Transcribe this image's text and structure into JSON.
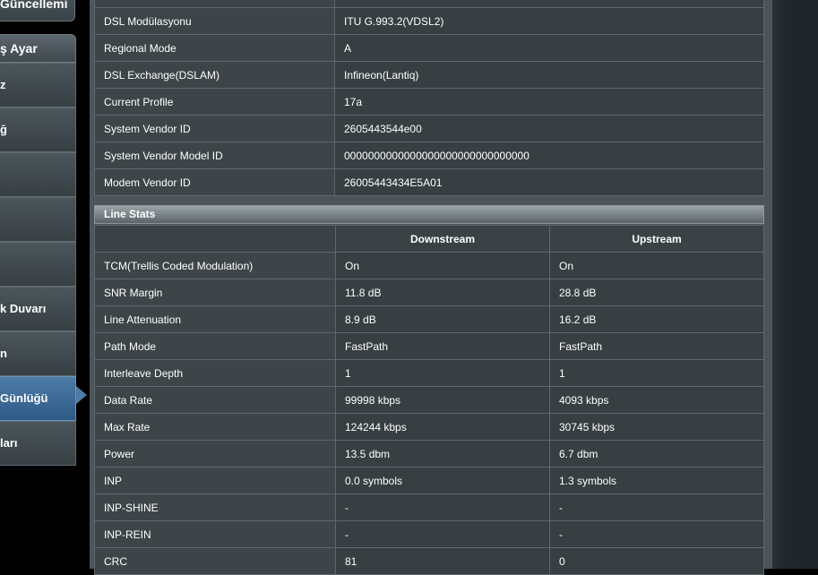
{
  "sidebar": {
    "top_item": "Güncellemi",
    "header": "ş Ayar",
    "items": [
      {
        "label": "z"
      },
      {
        "label": "ğ"
      },
      {
        "label": ""
      },
      {
        "label": ""
      },
      {
        "label": ""
      },
      {
        "label": "k Duvarı"
      },
      {
        "label": "n"
      },
      {
        "label": "Günlüğü",
        "active": true
      },
      {
        "label": "ları"
      }
    ]
  },
  "info": {
    "rows": [
      {
        "label": "",
        "value": ""
      },
      {
        "label": "DSL Modülasyonu",
        "value": "ITU G.993.2(VDSL2)"
      },
      {
        "label": "Regional Mode",
        "value": "A"
      },
      {
        "label": "DSL Exchange(DSLAM)",
        "value": "Infineon(Lantiq)"
      },
      {
        "label": "Current Profile",
        "value": "17a"
      },
      {
        "label": "System Vendor ID",
        "value": "2605443544e00"
      },
      {
        "label": "System Vendor Model ID",
        "value": "0000000000000000000000000000000"
      },
      {
        "label": "Modem Vendor ID",
        "value": "26005443434E5A01"
      }
    ]
  },
  "line_stats": {
    "title": "Line Stats",
    "headers": [
      "",
      "Downstream",
      "Upstream"
    ],
    "rows": [
      {
        "label": "TCM(Trellis Coded Modulation)",
        "down": "On",
        "up": "On"
      },
      {
        "label": "SNR Margin",
        "down": "11.8 dB",
        "up": "28.8 dB"
      },
      {
        "label": "Line Attenuation",
        "down": "8.9 dB",
        "up": "16.2 dB"
      },
      {
        "label": "Path Mode",
        "down": "FastPath",
        "up": "FastPath"
      },
      {
        "label": "Interleave Depth",
        "down": "1",
        "up": "1"
      },
      {
        "label": "Data Rate",
        "down": "99998 kbps",
        "up": "4093 kbps"
      },
      {
        "label": "Max Rate",
        "down": "124244 kbps",
        "up": "30745 kbps"
      },
      {
        "label": "Power",
        "down": "13.5 dbm",
        "up": "6.7 dbm"
      },
      {
        "label": "INP",
        "down": "0.0 symbols",
        "up": "1.3 symbols"
      },
      {
        "label": "INP-SHINE",
        "down": "-",
        "up": "-"
      },
      {
        "label": "INP-REIN",
        "down": "-",
        "up": "-"
      },
      {
        "label": "CRC",
        "down": "81",
        "up": "0"
      }
    ]
  }
}
